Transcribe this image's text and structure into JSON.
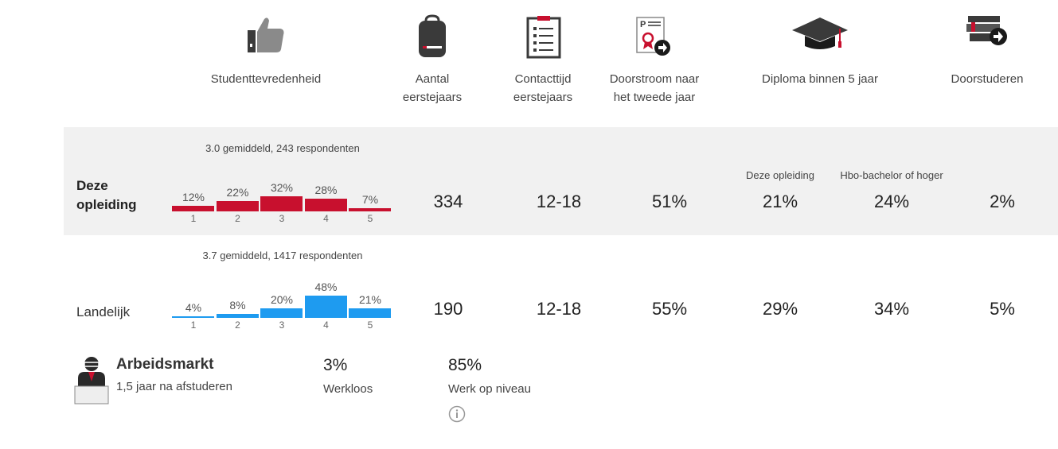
{
  "colors": {
    "accent_red": "#c8102e",
    "accent_blue": "#1e9bf0",
    "row_bg": "#f1f1f1"
  },
  "header": {
    "satisfaction": "Studenttevredenheid",
    "first_years": "Aantal eerstejaars",
    "contact": "Contacttijd eerstejaars",
    "doorstroom": "Doorstroom naar het tweede jaar",
    "diploma": "Diploma binnen 5 jaar",
    "doorstuderen": "Doorstuderen",
    "icons": [
      "thumbs-up-icon",
      "backpack-icon",
      "clipboard-icon",
      "certificate-icon",
      "graduation-cap-icon",
      "books-icon"
    ]
  },
  "rows": {
    "deze": {
      "label": "Deze opleiding",
      "summary": "3.0 gemiddeld, 243 respondenten",
      "dist": [
        "12%",
        "22%",
        "32%",
        "28%",
        "7%"
      ],
      "dist_values": [
        12,
        22,
        32,
        28,
        7
      ],
      "scale": [
        "1",
        "2",
        "3",
        "4",
        "5"
      ],
      "eerstejaars": "334",
      "contacttijd": "12-18",
      "doorstroom": "51%",
      "diploma_deze": "21%",
      "diploma_hbo": "24%",
      "doorstuderen": "2%",
      "diploma_sub_deze": "Deze opleiding",
      "diploma_sub_hbo": "Hbo-bachelor of hoger"
    },
    "landelijk": {
      "label": "Landelijk",
      "summary": "3.7 gemiddeld, 1417 respondenten",
      "dist": [
        "4%",
        "8%",
        "20%",
        "48%",
        "21%"
      ],
      "dist_values": [
        4,
        8,
        20,
        48,
        21
      ],
      "scale": [
        "1",
        "2",
        "3",
        "4",
        "5"
      ],
      "eerstejaars": "190",
      "contacttijd": "12-18",
      "doorstroom": "55%",
      "diploma_deze": "29%",
      "diploma_hbo": "34%",
      "doorstuderen": "5%"
    }
  },
  "arbeidsmarkt": {
    "title": "Arbeidsmarkt",
    "subtitle": "1,5 jaar na afstuderen",
    "werkloos_value": "3%",
    "werkloos_label": "Werkloos",
    "niveau_value": "85%",
    "niveau_label": "Werk op niveau",
    "icons": [
      "teacher-icon",
      "info-icon"
    ]
  }
}
